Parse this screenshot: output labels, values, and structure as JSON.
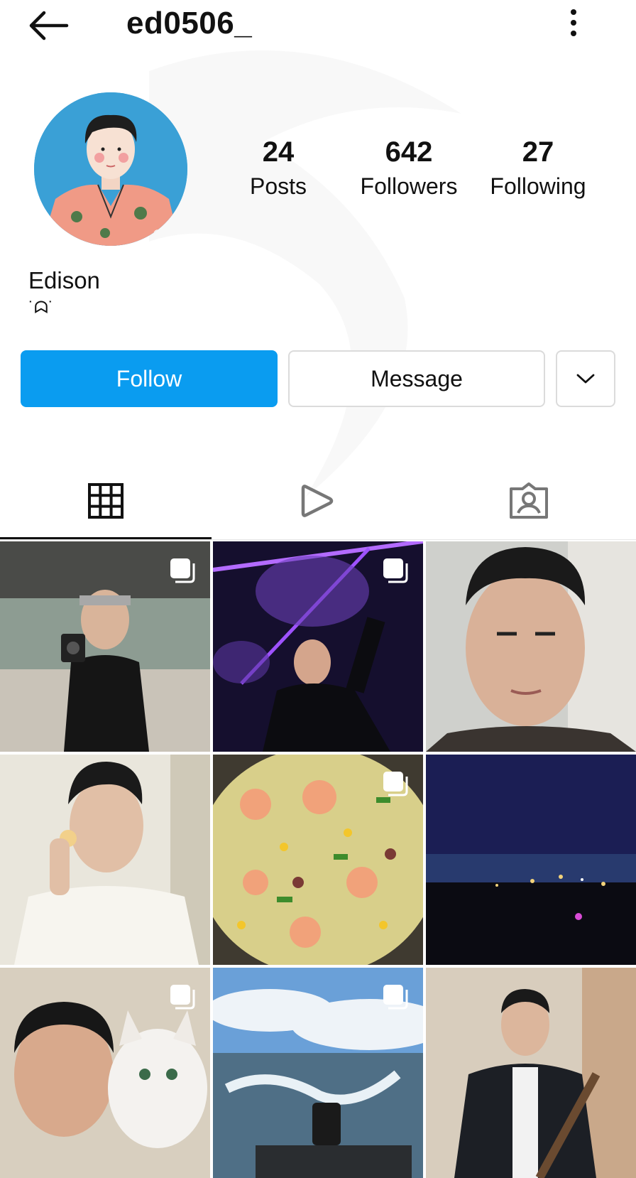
{
  "header": {
    "username": "ed0506_",
    "back_icon": "arrow-left-icon",
    "more_icon": "more-vertical-icon"
  },
  "profile": {
    "stats": [
      {
        "value": "24",
        "label": "Posts"
      },
      {
        "value": "642",
        "label": "Followers"
      },
      {
        "value": "27",
        "label": "Following"
      }
    ],
    "name": "Edison",
    "bio": "˙ᗣ˙"
  },
  "actions": {
    "follow_label": "Follow",
    "message_label": "Message",
    "more_icon": "chevron-down-icon"
  },
  "tabs": [
    {
      "icon": "grid-icon",
      "active": true
    },
    {
      "icon": "reels-play-icon",
      "active": false
    },
    {
      "icon": "tagged-person-icon",
      "active": false
    }
  ],
  "posts": [
    {
      "subject": "gym mirror selfie",
      "multi": true
    },
    {
      "subject": "purple neon lights",
      "multi": true
    },
    {
      "subject": "face close-up",
      "multi": false
    },
    {
      "subject": "portrait holding flower",
      "multi": false
    },
    {
      "subject": "shrimp fried rice",
      "multi": true
    },
    {
      "subject": "city lights at night",
      "multi": false
    },
    {
      "subject": "selfie with cat",
      "multi": true
    },
    {
      "subject": "boat wake on lake",
      "multi": true
    },
    {
      "subject": "portrait with guitar",
      "multi": false
    }
  ],
  "colors": {
    "follow_button": "#0a9cf0",
    "border": "#dbdbdb",
    "avatar_bg": "#3aa0d6"
  }
}
